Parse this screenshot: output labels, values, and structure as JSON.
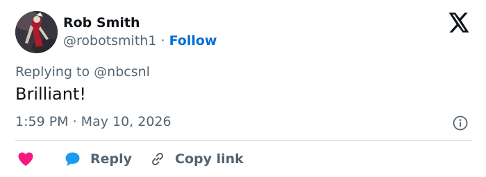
{
  "author": {
    "name": "Rob Smith",
    "handle": "@robotsmith1",
    "separator": "·",
    "follow_label": "Follow"
  },
  "reply_context": "Replying to @nbcsnl",
  "tweet": {
    "text": "Brilliant!",
    "timestamp": "1:59 PM · May 10, 2026"
  },
  "actions": {
    "like_icon": "heart-icon",
    "reply_label": "Reply",
    "reply_icon": "speech-bubble-icon",
    "copy_label": "Copy link",
    "copy_icon": "link-icon"
  },
  "icons": {
    "brand": "x-logo-icon",
    "info": "info-icon"
  },
  "colors": {
    "text_primary": "#0f1419",
    "text_secondary": "#536471",
    "follow": "#006fd6",
    "heart": "#f91880",
    "reply_bubble": "#1d9bf0",
    "divider": "#cfd9de"
  }
}
